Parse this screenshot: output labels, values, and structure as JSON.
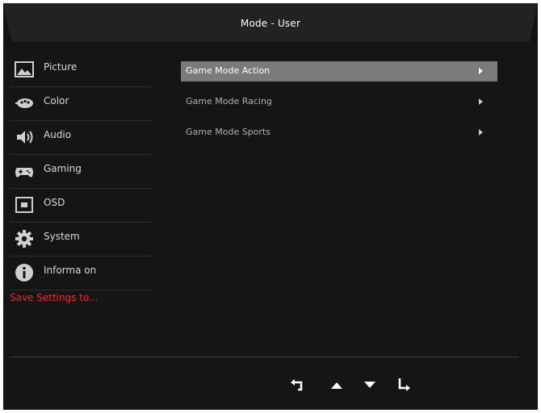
{
  "header": {
    "title": "Mode - User"
  },
  "sidebar": {
    "items": [
      {
        "label": "Picture",
        "icon": "picture-icon"
      },
      {
        "label": "Color",
        "icon": "palette-icon"
      },
      {
        "label": "Audio",
        "icon": "speaker-icon"
      },
      {
        "label": "Gaming",
        "icon": "gamepad-icon"
      },
      {
        "label": "OSD",
        "icon": "osd-icon"
      },
      {
        "label": "System",
        "icon": "gear-icon"
      },
      {
        "label": "Informa on",
        "icon": "info-icon"
      }
    ],
    "save_label": "Save Settings to..."
  },
  "main": {
    "items": [
      {
        "label": "Game Mode Action",
        "selected": true
      },
      {
        "label": "Game Mode Racing",
        "selected": false
      },
      {
        "label": "Game Mode Sports",
        "selected": false
      }
    ]
  },
  "footer": {
    "buttons": [
      "back-icon",
      "up-icon",
      "down-icon",
      "enter-icon"
    ]
  },
  "colors": {
    "background": "#151515",
    "selected_row": "#7b7b7b",
    "save_text": "#e0322c"
  }
}
